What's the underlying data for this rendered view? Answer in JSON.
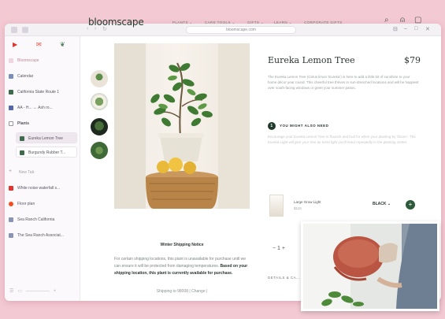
{
  "browser": {
    "url": "bloomscape.com"
  },
  "sidebar": {
    "items": [
      {
        "label": "Bloomscape",
        "icon": "home-icon"
      },
      {
        "label": "Calendar",
        "icon": "calendar-icon"
      },
      {
        "label": "California State Route 1",
        "icon": "bookmark-icon"
      },
      {
        "label": "AA - H... ↔ Ash ro...",
        "icon": "tab-icon"
      },
      {
        "label": "Plants",
        "icon": "folder-icon"
      },
      {
        "label": "Eureka Lemon Tree",
        "icon": "plant-tab-icon"
      },
      {
        "label": "Burgundy Rubber T...",
        "icon": "plant-tab-icon"
      },
      {
        "label": "New Tab",
        "icon": "plus-icon"
      },
      {
        "label": "White noise waterfall s...",
        "icon": "youtube-icon"
      },
      {
        "label": "Floor plan",
        "icon": "figma-icon"
      },
      {
        "label": "Sea Ranch California",
        "icon": "tab-icon"
      },
      {
        "label": "The Sea Ranch Associat...",
        "icon": "tab-icon"
      }
    ]
  },
  "header": {
    "logo": "bloomscape",
    "nav": [
      "PLANTS ⌄",
      "CARE TOOLS ⌄",
      "GIFTS ⌄",
      "LEARN ⌄",
      "CORPORATE GIFTS"
    ]
  },
  "product": {
    "title": "Eureka Lemon Tree",
    "price": "$79",
    "description": "The Eureka Lemon Tree (Citrus limon 'Eureka') is here to add a little bit of sunshine to your home décor year round. This cheerful tree thrives in sun-drenched locations and will be happiest over south-facing windows or greet your summer patios.",
    "also_need_number": "1",
    "also_need_label": "YOU MIGHT ALSO NEED",
    "also_need_text": "Encourage your Eureka Lemon Tree to flourish and fruit for when your planting by 'bloom'. The Eureka Light will give your tree an extra light you'll need repeatedly in the planting center.",
    "addon": {
      "name": "Large Grow Light",
      "price": "$115",
      "select": "BLACK ⌄",
      "add": "+"
    },
    "qty": "−   1   +",
    "details": "DETAILS & CA..."
  },
  "notice": {
    "title": "Winter Shipping Notice",
    "body_start": "For certain shipping locations, this plant is unavailable for purchase until we can ensure it will be protected from damaging temperatures.",
    "body_bold": "Based on your shipping location, this plant is currently available for purchase.",
    "ship_to": "Shipping to 98008 | Change |"
  },
  "colors": {
    "background": "#f3c9d3",
    "brand": "#1f3a2c",
    "accent": "#2d5a3a"
  }
}
